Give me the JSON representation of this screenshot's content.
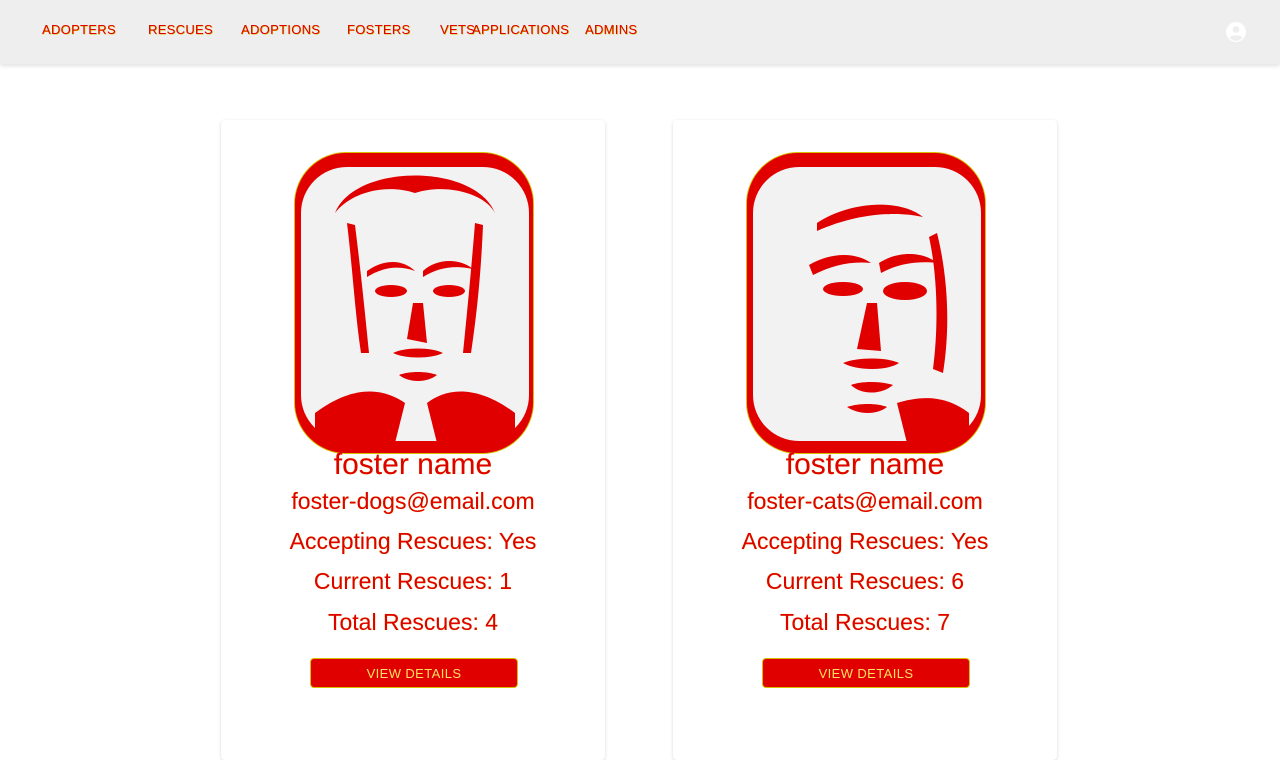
{
  "nav": {
    "items": [
      {
        "label": "ADOPTERS"
      },
      {
        "label": "RESCUES"
      },
      {
        "label": "ADOPTIONS"
      },
      {
        "label": "FOSTERS"
      },
      {
        "label": "VETS"
      },
      {
        "label": "APPLICATIONS"
      },
      {
        "label": "ADMINS"
      }
    ],
    "profile_icon": "account-circle-icon"
  },
  "fosters": [
    {
      "name": "foster name",
      "email": "foster-dogs@email.com",
      "accepting": "Accepting Rescues: Yes",
      "current": "Current Rescues: 1",
      "total": "Total Rescues: 4",
      "button": "VIEW DETAILS"
    },
    {
      "name": "foster name",
      "email": "foster-cats@email.com",
      "accepting": "Accepting Rescues: Yes",
      "current": "Current Rescues: 6",
      "total": "Total Rescues: 7",
      "button": "VIEW DETAILS"
    }
  ],
  "colors": {
    "accent": "#e00000",
    "outline": "#d4c000",
    "topbar": "#eeeeee"
  }
}
